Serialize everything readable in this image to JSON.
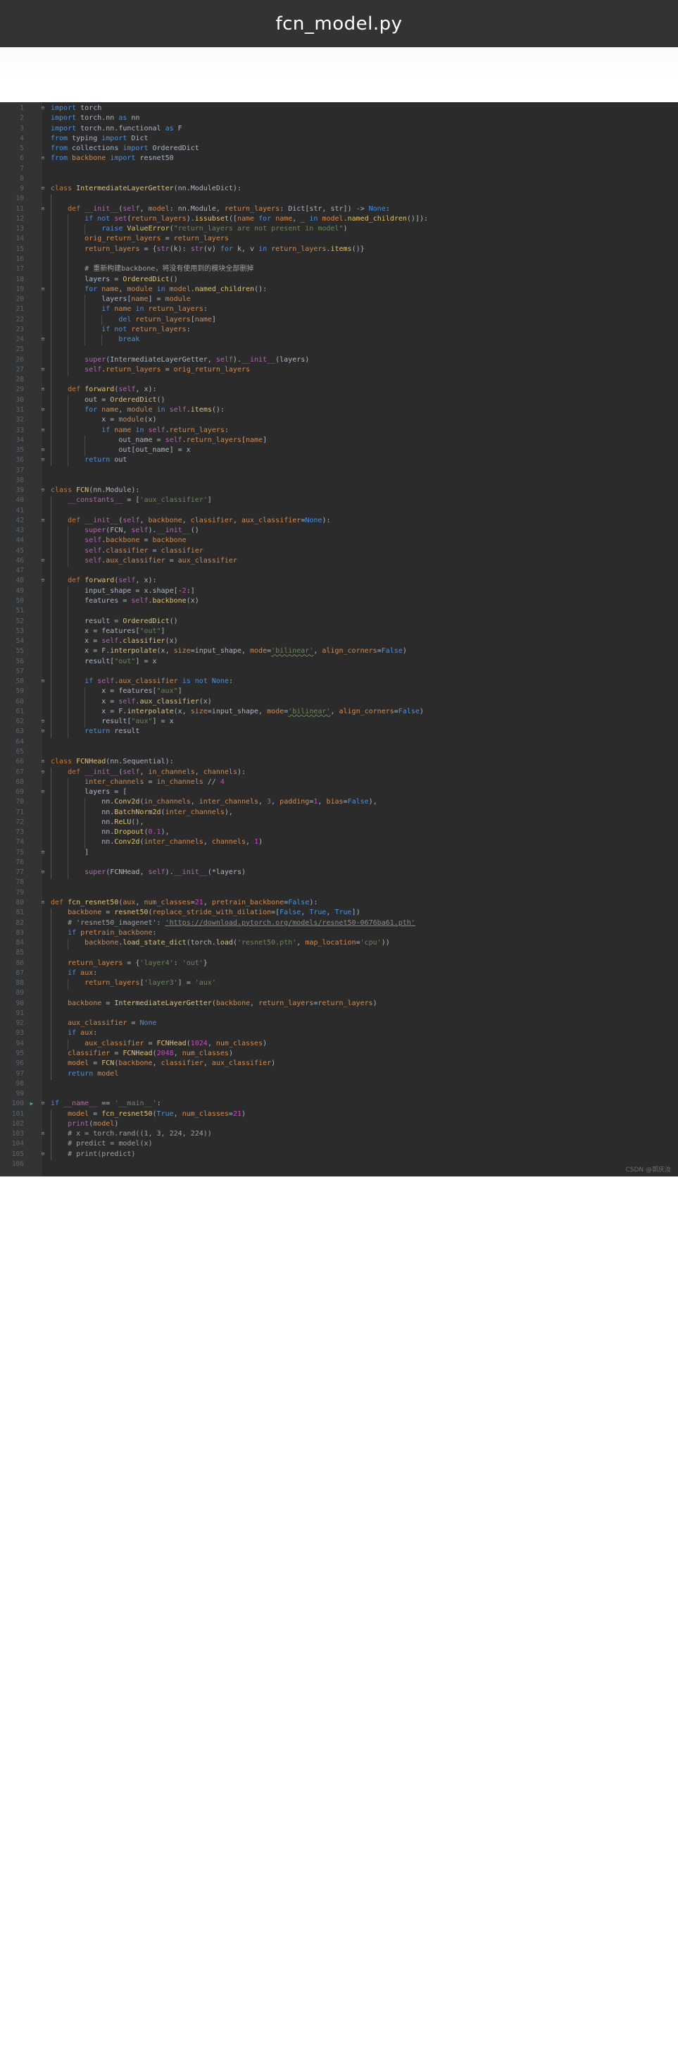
{
  "window": {
    "title": "fcn_model.py"
  },
  "editor": {
    "theme": "darcula",
    "background": "#2b2b2b",
    "gutter_background": "#313335",
    "line_number_color": "#606366",
    "default_text_color": "#a9b7c6",
    "keyword_color": "#4b8fe2",
    "string_color": "#6a8759",
    "number_color": "#cc47c4",
    "comment_color": "#a0a0a0",
    "self_color": "#b066b0",
    "param_color": "#d5894a",
    "function_color": "#e0c46c",
    "first_line_number": 1,
    "last_line_number": 106,
    "run_marker_line": 100,
    "language": "Python"
  },
  "watermark": {
    "text": "CSDN @郭庆汝"
  },
  "code_lines": [
    {
      "n": 1,
      "text": "import torch"
    },
    {
      "n": 2,
      "text": "import torch.nn as nn"
    },
    {
      "n": 3,
      "text": "import torch.nn.functional as F"
    },
    {
      "n": 4,
      "text": "from typing import Dict"
    },
    {
      "n": 5,
      "text": "from collections import OrderedDict"
    },
    {
      "n": 6,
      "text": "from backbone import resnet50"
    },
    {
      "n": 7,
      "text": ""
    },
    {
      "n": 8,
      "text": ""
    },
    {
      "n": 9,
      "text": "class IntermediateLayerGetter(nn.ModuleDict):"
    },
    {
      "n": 10,
      "text": ""
    },
    {
      "n": 11,
      "text": "    def __init__(self, model: nn.Module, return_layers: Dict[str, str]) -> None:"
    },
    {
      "n": 12,
      "text": "        if not set(return_layers).issubset([name for name, _ in model.named_children()]):"
    },
    {
      "n": 13,
      "text": "            raise ValueError(\"return_layers are not present in model\")"
    },
    {
      "n": 14,
      "text": "        orig_return_layers = return_layers"
    },
    {
      "n": 15,
      "text": "        return_layers = {str(k): str(v) for k, v in return_layers.items()}"
    },
    {
      "n": 16,
      "text": ""
    },
    {
      "n": 17,
      "text": "        # 重新构建backbone，将没有使用到的模块全部删掉"
    },
    {
      "n": 18,
      "text": "        layers = OrderedDict()"
    },
    {
      "n": 19,
      "text": "        for name, module in model.named_children():"
    },
    {
      "n": 20,
      "text": "            layers[name] = module"
    },
    {
      "n": 21,
      "text": "            if name in return_layers:"
    },
    {
      "n": 22,
      "text": "                del return_layers[name]"
    },
    {
      "n": 23,
      "text": "            if not return_layers:"
    },
    {
      "n": 24,
      "text": "                break"
    },
    {
      "n": 25,
      "text": ""
    },
    {
      "n": 26,
      "text": "        super(IntermediateLayerGetter, self).__init__(layers)"
    },
    {
      "n": 27,
      "text": "        self.return_layers = orig_return_layers"
    },
    {
      "n": 28,
      "text": ""
    },
    {
      "n": 29,
      "text": "    def forward(self, x):"
    },
    {
      "n": 30,
      "text": "        out = OrderedDict()"
    },
    {
      "n": 31,
      "text": "        for name, module in self.items():"
    },
    {
      "n": 32,
      "text": "            x = module(x)"
    },
    {
      "n": 33,
      "text": "            if name in self.return_layers:"
    },
    {
      "n": 34,
      "text": "                out_name = self.return_layers[name]"
    },
    {
      "n": 35,
      "text": "                out[out_name] = x"
    },
    {
      "n": 36,
      "text": "        return out"
    },
    {
      "n": 37,
      "text": ""
    },
    {
      "n": 38,
      "text": ""
    },
    {
      "n": 39,
      "text": "class FCN(nn.Module):"
    },
    {
      "n": 40,
      "text": "    __constants__ = ['aux_classifier']"
    },
    {
      "n": 41,
      "text": ""
    },
    {
      "n": 42,
      "text": "    def __init__(self, backbone, classifier, aux_classifier=None):"
    },
    {
      "n": 43,
      "text": "        super(FCN, self).__init__()"
    },
    {
      "n": 44,
      "text": "        self.backbone = backbone"
    },
    {
      "n": 45,
      "text": "        self.classifier = classifier"
    },
    {
      "n": 46,
      "text": "        self.aux_classifier = aux_classifier"
    },
    {
      "n": 47,
      "text": ""
    },
    {
      "n": 48,
      "text": "    def forward(self, x):"
    },
    {
      "n": 49,
      "text": "        input_shape = x.shape[-2:]"
    },
    {
      "n": 50,
      "text": "        features = self.backbone(x)"
    },
    {
      "n": 51,
      "text": ""
    },
    {
      "n": 52,
      "text": "        result = OrderedDict()"
    },
    {
      "n": 53,
      "text": "        x = features[\"out\"]"
    },
    {
      "n": 54,
      "text": "        x = self.classifier(x)"
    },
    {
      "n": 55,
      "text": "        x = F.interpolate(x, size=input_shape, mode='bilinear', align_corners=False)"
    },
    {
      "n": 56,
      "text": "        result[\"out\"] = x"
    },
    {
      "n": 57,
      "text": ""
    },
    {
      "n": 58,
      "text": "        if self.aux_classifier is not None:"
    },
    {
      "n": 59,
      "text": "            x = features[\"aux\"]"
    },
    {
      "n": 60,
      "text": "            x = self.aux_classifier(x)"
    },
    {
      "n": 61,
      "text": "            x = F.interpolate(x, size=input_shape, mode='bilinear', align_corners=False)"
    },
    {
      "n": 62,
      "text": "            result[\"aux\"] = x"
    },
    {
      "n": 63,
      "text": "        return result"
    },
    {
      "n": 64,
      "text": ""
    },
    {
      "n": 65,
      "text": ""
    },
    {
      "n": 66,
      "text": "class FCNHead(nn.Sequential):"
    },
    {
      "n": 67,
      "text": "    def __init__(self, in_channels, channels):"
    },
    {
      "n": 68,
      "text": "        inter_channels = in_channels // 4"
    },
    {
      "n": 69,
      "text": "        layers = ["
    },
    {
      "n": 70,
      "text": "            nn.Conv2d(in_channels, inter_channels, 3, padding=1, bias=False),"
    },
    {
      "n": 71,
      "text": "            nn.BatchNorm2d(inter_channels),"
    },
    {
      "n": 72,
      "text": "            nn.ReLU(),"
    },
    {
      "n": 73,
      "text": "            nn.Dropout(0.1),"
    },
    {
      "n": 74,
      "text": "            nn.Conv2d(inter_channels, channels, 1)"
    },
    {
      "n": 75,
      "text": "        ]"
    },
    {
      "n": 76,
      "text": ""
    },
    {
      "n": 77,
      "text": "        super(FCNHead, self).__init__(*layers)"
    },
    {
      "n": 78,
      "text": ""
    },
    {
      "n": 79,
      "text": ""
    },
    {
      "n": 80,
      "text": "def fcn_resnet50(aux, num_classes=21, pretrain_backbone=False):"
    },
    {
      "n": 81,
      "text": "    backbone = resnet50(replace_stride_with_dilation=[False, True, True])"
    },
    {
      "n": 82,
      "text": "    # 'resnet50_imagenet': 'https://download.pytorch.org/models/resnet50-0676ba61.pth'"
    },
    {
      "n": 83,
      "text": "    if pretrain_backbone:"
    },
    {
      "n": 84,
      "text": "        backbone.load_state_dict(torch.load('resnet50.pth', map_location='cpu'))"
    },
    {
      "n": 85,
      "text": ""
    },
    {
      "n": 86,
      "text": "    return_layers = {'layer4': 'out'}"
    },
    {
      "n": 87,
      "text": "    if aux:"
    },
    {
      "n": 88,
      "text": "        return_layers['layer3'] = 'aux'"
    },
    {
      "n": 89,
      "text": ""
    },
    {
      "n": 90,
      "text": "    backbone = IntermediateLayerGetter(backbone, return_layers=return_layers)"
    },
    {
      "n": 91,
      "text": ""
    },
    {
      "n": 92,
      "text": "    aux_classifier = None"
    },
    {
      "n": 93,
      "text": "    if aux:"
    },
    {
      "n": 94,
      "text": "        aux_classifier = FCNHead(1024, num_classes)"
    },
    {
      "n": 95,
      "text": "    classifier = FCNHead(2048, num_classes)"
    },
    {
      "n": 96,
      "text": "    model = FCN(backbone, classifier, aux_classifier)"
    },
    {
      "n": 97,
      "text": "    return model"
    },
    {
      "n": 98,
      "text": ""
    },
    {
      "n": 99,
      "text": ""
    },
    {
      "n": 100,
      "text": "if __name__ == '__main__':"
    },
    {
      "n": 101,
      "text": "    model = fcn_resnet50(True, num_classes=21)"
    },
    {
      "n": 102,
      "text": "    print(model)"
    },
    {
      "n": 103,
      "text": "    # x = torch.rand((1, 3, 224, 224))"
    },
    {
      "n": 104,
      "text": "    # predict = model(x)"
    },
    {
      "n": 105,
      "text": "    # print(predict)"
    },
    {
      "n": 106,
      "text": ""
    }
  ],
  "fold_markers": [
    1,
    6,
    9,
    11,
    19,
    24,
    27,
    29,
    31,
    33,
    35,
    36,
    39,
    42,
    46,
    48,
    58,
    62,
    63,
    66,
    67,
    69,
    75,
    77,
    80,
    100,
    103,
    105
  ]
}
